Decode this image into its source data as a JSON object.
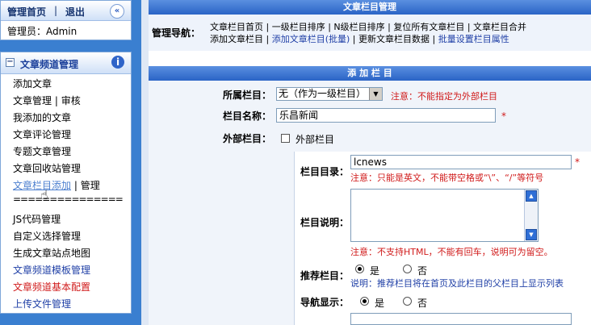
{
  "sidebar": {
    "header_title": "管理首页",
    "sep": "|",
    "logout": "退出",
    "collapse_glyph": "«",
    "admin_label": "管理员：Admin",
    "section_title": "文章频道管理",
    "info_glyph": "i",
    "items": [
      {
        "label": "添加文章"
      },
      {
        "label": "文章管理",
        "extra": "审核"
      },
      {
        "label": "我添加的文章"
      },
      {
        "label": "文章评论管理"
      },
      {
        "label": "专题文章管理"
      },
      {
        "label": "文章回收站管理"
      },
      {
        "label": "文章栏目添加",
        "extra": "管理"
      },
      {
        "label": "==============="
      },
      {
        "label": "JS代码管理"
      },
      {
        "label": "自定义选择管理"
      },
      {
        "label": "生成文章站点地图"
      },
      {
        "label": "文章频道模板管理"
      },
      {
        "label": "文章频道基本配置"
      },
      {
        "label": "上传文件管理"
      }
    ]
  },
  "content": {
    "top_title": "文章栏目管理",
    "nav_label": "管理导航：",
    "nav_links_row1": [
      "文章栏目首页",
      "一级栏目排序",
      "N级栏目排序",
      "复位所有文章栏目",
      "文章栏目合并"
    ],
    "nav_links_row2": [
      "添加文章栏目",
      "添加文章栏目(批量)",
      "更新文章栏目数据",
      "批量设置栏目属性"
    ],
    "section_title": "添 加 栏 目",
    "fields": {
      "parent": {
        "label": "所属栏目：",
        "value": "无（作为一级栏目）",
        "hint": "注意：不能指定为外部栏目"
      },
      "name": {
        "label": "栏目名称：",
        "value": "乐昌新闻",
        "required": "*"
      },
      "external": {
        "label": "外部栏目：",
        "option": "外部栏目"
      },
      "dir": {
        "label": "栏目目录：",
        "value": "lcnews",
        "required": "*",
        "hint": "注意：只能是英文，不能带空格或“\\”、“/”等符号"
      },
      "desc": {
        "label": "栏目说明：",
        "hint": "注意：不支持HTML，不能有回车，说明可为留空。"
      },
      "recommend": {
        "label": "推荐栏目：",
        "yes": "是",
        "no": "否",
        "hint": "说明：推荐栏目将在首页及此栏目的父栏目上显示列表"
      },
      "navshow": {
        "label": "导航显示：",
        "yes": "是",
        "no": "否"
      }
    },
    "colors": {
      "accent": "#2a64c6",
      "red": "#d01a1a",
      "link": "#1f3fa6"
    }
  }
}
